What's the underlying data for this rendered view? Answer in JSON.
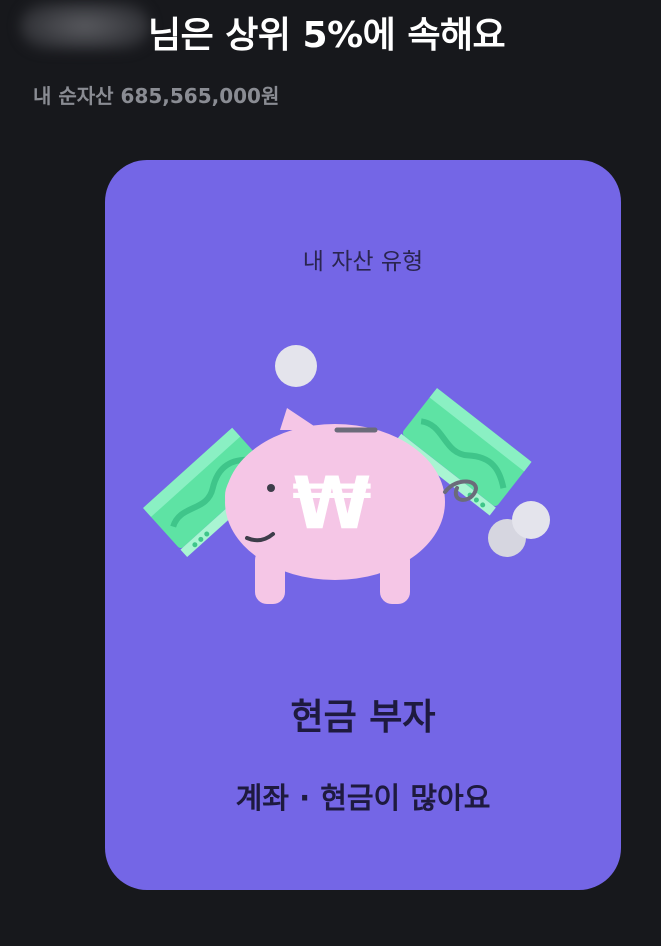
{
  "header": {
    "title_suffix": "님은 상위 5%에 속해요",
    "net_assets": "내 순자산 685,565,000원"
  },
  "card": {
    "label": "내 자산 유형",
    "type_title": "현금 부자",
    "type_description": "계좌 · 현금이 많아요",
    "background_color": "#7466e6"
  },
  "illustration": {
    "piggy_color": "#f5c6e6",
    "currency_symbol": "₩",
    "banknote_color": "#5ee3a4",
    "coin_color": "#e4e4ec"
  }
}
